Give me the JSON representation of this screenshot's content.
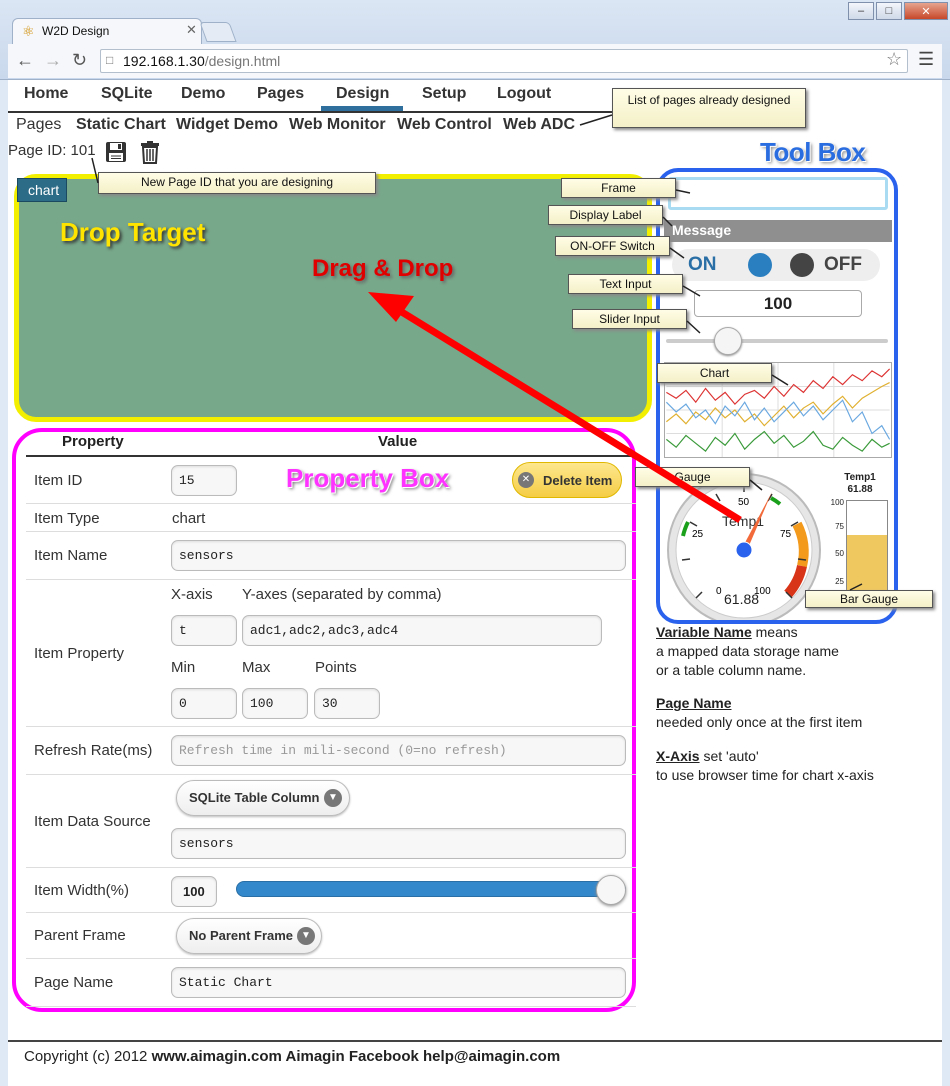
{
  "browser": {
    "tab_title": "W2D Design",
    "url_host": "192.168.1.30",
    "url_path": "/design.html"
  },
  "nav": {
    "items": [
      "Home",
      "SQLite",
      "Demo",
      "Pages",
      "Design",
      "Setup",
      "Logout"
    ],
    "active": "Design"
  },
  "pages": {
    "label": "Pages",
    "links": [
      "Static Chart",
      "Widget Demo",
      "Web Monitor",
      "Web Control",
      "Web ADC"
    ]
  },
  "page_id": {
    "label": "Page ID: 101"
  },
  "annotations": {
    "pages_list": "List of pages already designed",
    "new_page_id": "New Page ID that you are designing",
    "frame": "Frame",
    "display_label": "Display Label",
    "on_off_switch": "ON-OFF Switch",
    "text_input": "Text Input",
    "slider_input": "Slider Input",
    "chart": "Chart",
    "gauge": "Gauge",
    "bar_gauge": "Bar Gauge"
  },
  "titles": {
    "toolbox": "Tool Box",
    "drop_target": "Drop Target",
    "drag_drop": "Drag & Drop",
    "property_box": "Property Box"
  },
  "drop_target": {
    "item_chip": "chart"
  },
  "toolbox": {
    "message": "Message",
    "switch_on": "ON",
    "switch_off": "OFF",
    "text_value": "100",
    "slider_level": 0.28,
    "gauge": {
      "label": "Temp1",
      "value": "61.88",
      "ticks": [
        "0",
        "25",
        "50",
        "75",
        "100"
      ]
    },
    "bar_gauge": {
      "title": "Temp1",
      "value": "61.88",
      "ticks": [
        "100",
        "75",
        "50",
        "25"
      ],
      "level": 0.62
    }
  },
  "help": {
    "variable_name_term": "Variable Name",
    "variable_name_text1": " means",
    "variable_name_text2": "a mapped data storage name",
    "variable_name_text3": "or a table column name.",
    "page_name_term": "Page Name",
    "page_name_text": "needed only once at the first item",
    "xaxis_term": "X-Axis",
    "xaxis_text1": " set 'auto'",
    "xaxis_text2": "to use browser time for chart x-axis"
  },
  "property": {
    "header_property": "Property",
    "header_value": "Value",
    "delete_label": "Delete Item",
    "item_id_label": "Item ID",
    "item_id": "15",
    "item_type_label": "Item Type",
    "item_type": "chart",
    "item_name_label": "Item Name",
    "item_name": "sensors",
    "item_property_label": "Item Property",
    "xaxis_label": "X-axis",
    "yaxes_label": "Y-axes (separated by comma)",
    "xaxis": "t",
    "yaxes": "adc1,adc2,adc3,adc4",
    "min_label": "Min",
    "max_label": "Max",
    "points_label": "Points",
    "min": "0",
    "max": "100",
    "points": "30",
    "refresh_label": "Refresh Rate(ms)",
    "refresh_placeholder": "Refresh time in mili-second (0=no refresh)",
    "source_label": "Item Data Source",
    "source_select": "SQLite Table Column",
    "source_value": "sensors",
    "width_label": "Item Width(%)",
    "width_value": "100",
    "parent_label": "Parent Frame",
    "parent_select": "No Parent Frame",
    "page_name_label": "Page Name",
    "page_name": "Static Chart"
  },
  "footer": {
    "copyright": "Copyright (c) 2012 ",
    "site": "www.aimagin.com",
    "facebook": " Aimagin Facebook ",
    "email": "help@aimagin.com"
  }
}
